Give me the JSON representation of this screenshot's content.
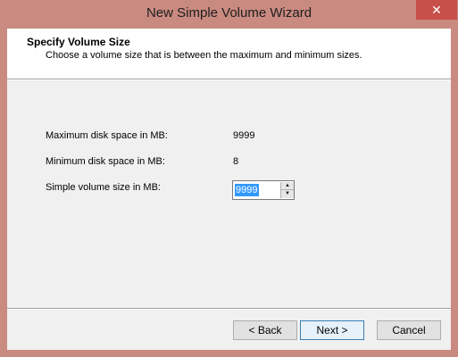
{
  "window": {
    "title": "New Simple Volume Wizard",
    "close_glyph": "✕"
  },
  "header": {
    "title": "Specify Volume Size",
    "subtitle": "Choose a volume size that is between the maximum and minimum sizes."
  },
  "fields": {
    "max_label": "Maximum disk space in MB:",
    "max_value": "9999",
    "min_label": "Minimum disk space in MB:",
    "min_value": "8",
    "size_label": "Simple volume size in MB:",
    "size_value": "9999",
    "spin_up_glyph": "▲",
    "spin_down_glyph": "▼"
  },
  "buttons": {
    "back": "< Back",
    "next": "Next >",
    "cancel": "Cancel"
  }
}
